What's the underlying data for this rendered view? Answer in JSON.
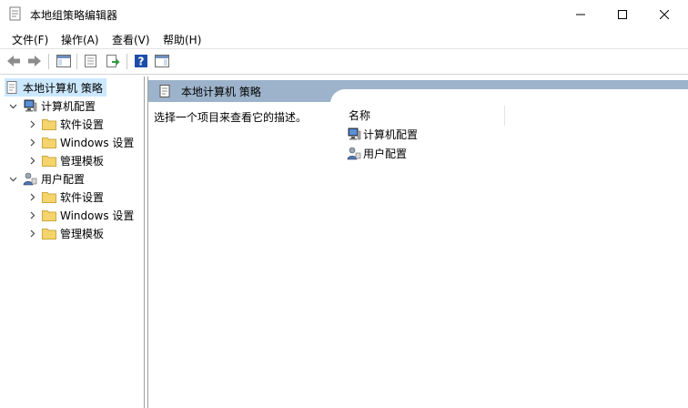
{
  "window": {
    "title": "本地组策略编辑器"
  },
  "menu": [
    "文件(F)",
    "操作(A)",
    "查看(V)",
    "帮助(H)"
  ],
  "tree": {
    "root": "本地计算机 策略",
    "computer": {
      "label": "计算机配置",
      "children": [
        "软件设置",
        "Windows 设置",
        "管理模板"
      ]
    },
    "user": {
      "label": "用户配置",
      "children": [
        "软件设置",
        "Windows 设置",
        "管理模板"
      ]
    }
  },
  "main": {
    "header": "本地计算机 策略",
    "description": "选择一个项目来查看它的描述。",
    "column": "名称",
    "items": [
      "计算机配置",
      "用户配置"
    ]
  },
  "colors": {
    "selection": "#cce8ff",
    "header_band": "#9db3cb",
    "folder": "#f5d46e",
    "help_icon": "#1c4ea8"
  }
}
